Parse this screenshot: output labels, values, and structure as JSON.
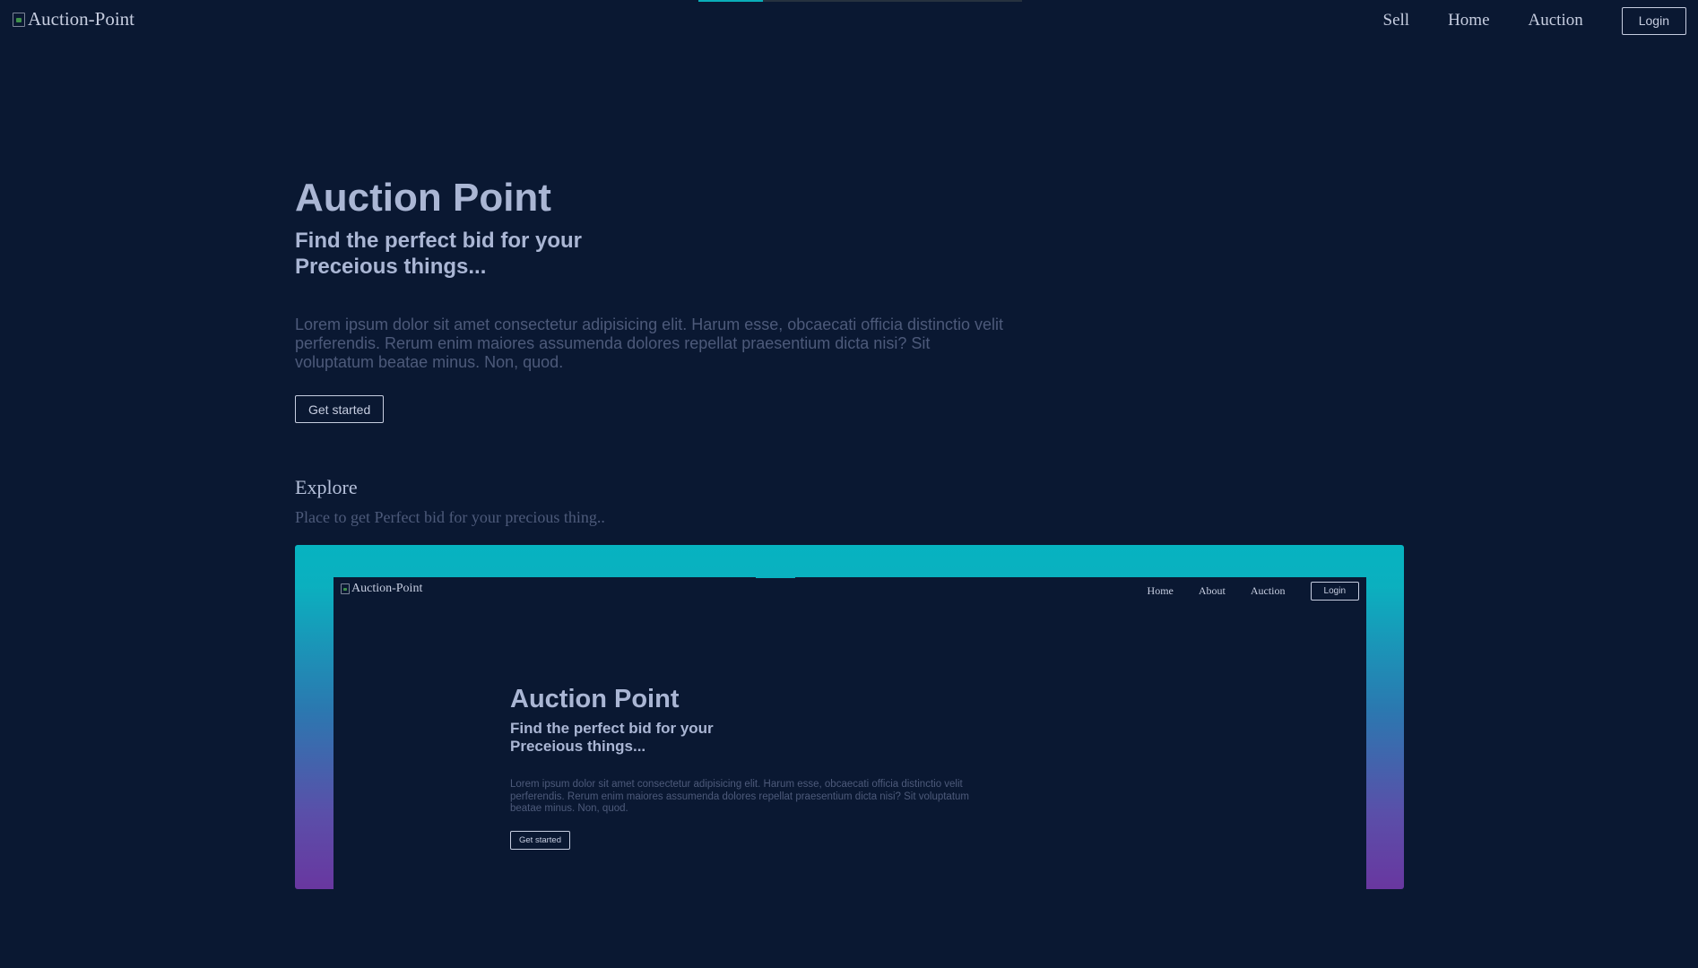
{
  "header": {
    "logo_alt": "Auction-Point",
    "load_progress": 0.2,
    "nav": [
      "Sell",
      "Home",
      "Auction"
    ],
    "login_label": "Login"
  },
  "hero": {
    "title": "Auction Point",
    "subtitle": "Find the perfect bid for your Preceious things...",
    "description": "Lorem ipsum dolor sit amet consectetur adipisicing elit. Harum esse, obcaecati officia distinctio velit perferendis. Rerum enim maiores assumenda dolores repellat praesentium dicta nisi? Sit voluptatum beatae minus. Non, quod.",
    "cta_label": "Get started"
  },
  "explore": {
    "title": "Explore",
    "subtitle": "Place to get Perfect bid for your precious thing.."
  },
  "preview": {
    "logo_alt": "Auction-Point",
    "nav": [
      "Home",
      "About",
      "Auction"
    ],
    "login_label": "Login",
    "title": "Auction Point",
    "subtitle": "Find the perfect bid for your Preceious things...",
    "description": "Lorem ipsum dolor sit amet consectetur adipisicing elit. Harum esse, obcaecati officia distinctio velit perferendis. Rerum enim maiores assumenda dolores repellat praesentium dicta nisi? Sit voluptatum beatae minus. Non, quod.",
    "cta_label": "Get started"
  },
  "colors": {
    "background": "#0a1832",
    "accent": "#0aaeb9",
    "gradient_end": "#6937a0",
    "heading": "#aab6d4",
    "muted_text": "#4d5a7a"
  }
}
